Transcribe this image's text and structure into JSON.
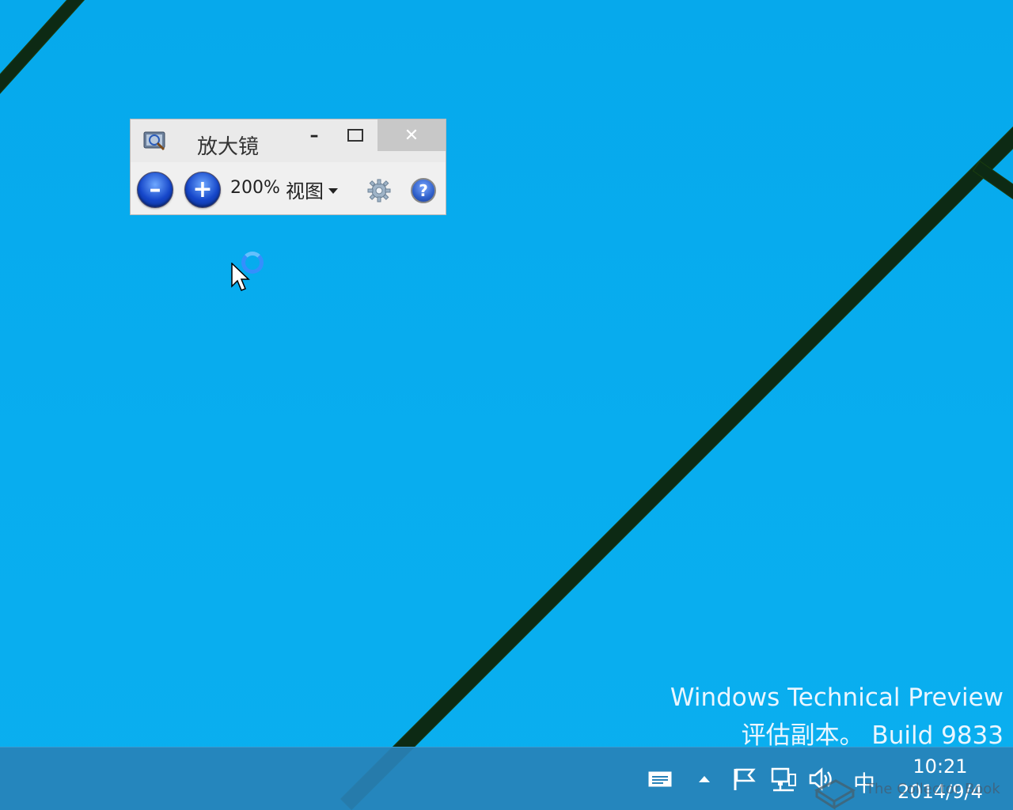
{
  "magnifier": {
    "title": "放大镜",
    "minimize_glyph": "–",
    "close_glyph": "✕",
    "zoom_out_glyph": "–",
    "zoom_in_glyph": "+",
    "zoom_level": "200%",
    "view_label": "视图",
    "help_glyph": "?"
  },
  "watermark": {
    "line1": "Windows Technical Preview",
    "line2": "评估副本。 Build 9833"
  },
  "taskbar": {
    "ime": "中",
    "time": "10:21",
    "date": "2014/9/4",
    "site_watermark": "The Collector Book"
  },
  "icons": {
    "magnifier_app": "magnifier-icon",
    "settings": "gear-icon",
    "help": "help-icon",
    "action_center": "message-icon",
    "show_hidden": "chevron-up-icon",
    "flag": "flag-icon",
    "network": "network-icon",
    "volume": "speaker-icon"
  },
  "colors": {
    "desktop": "#08adef",
    "taskbar": "#2882b9",
    "beam": "#0d2a14",
    "window_bg": "#f0f0f0",
    "close_button": "#c8c8c8"
  }
}
